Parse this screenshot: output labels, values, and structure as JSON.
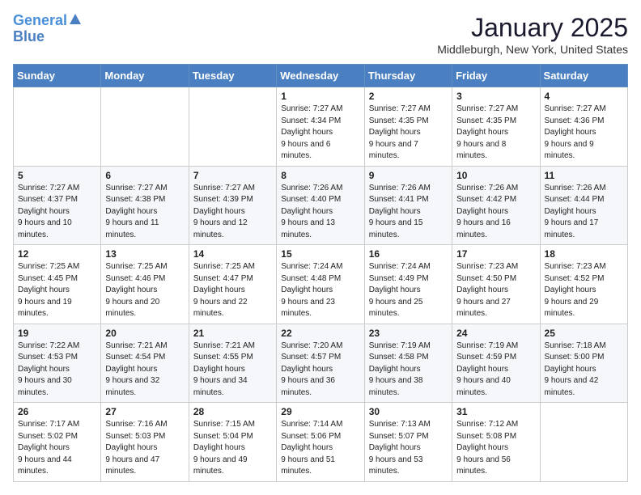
{
  "header": {
    "logo_line1": "General",
    "logo_line2": "Blue",
    "month": "January 2025",
    "location": "Middleburgh, New York, United States"
  },
  "days_of_week": [
    "Sunday",
    "Monday",
    "Tuesday",
    "Wednesday",
    "Thursday",
    "Friday",
    "Saturday"
  ],
  "weeks": [
    [
      {
        "day": "",
        "sunrise": "",
        "sunset": "",
        "daylight": ""
      },
      {
        "day": "",
        "sunrise": "",
        "sunset": "",
        "daylight": ""
      },
      {
        "day": "",
        "sunrise": "",
        "sunset": "",
        "daylight": ""
      },
      {
        "day": "1",
        "sunrise": "7:27 AM",
        "sunset": "4:34 PM",
        "daylight": "9 hours and 6 minutes."
      },
      {
        "day": "2",
        "sunrise": "7:27 AM",
        "sunset": "4:35 PM",
        "daylight": "9 hours and 7 minutes."
      },
      {
        "day": "3",
        "sunrise": "7:27 AM",
        "sunset": "4:35 PM",
        "daylight": "9 hours and 8 minutes."
      },
      {
        "day": "4",
        "sunrise": "7:27 AM",
        "sunset": "4:36 PM",
        "daylight": "9 hours and 9 minutes."
      }
    ],
    [
      {
        "day": "5",
        "sunrise": "7:27 AM",
        "sunset": "4:37 PM",
        "daylight": "9 hours and 10 minutes."
      },
      {
        "day": "6",
        "sunrise": "7:27 AM",
        "sunset": "4:38 PM",
        "daylight": "9 hours and 11 minutes."
      },
      {
        "day": "7",
        "sunrise": "7:27 AM",
        "sunset": "4:39 PM",
        "daylight": "9 hours and 12 minutes."
      },
      {
        "day": "8",
        "sunrise": "7:26 AM",
        "sunset": "4:40 PM",
        "daylight": "9 hours and 13 minutes."
      },
      {
        "day": "9",
        "sunrise": "7:26 AM",
        "sunset": "4:41 PM",
        "daylight": "9 hours and 15 minutes."
      },
      {
        "day": "10",
        "sunrise": "7:26 AM",
        "sunset": "4:42 PM",
        "daylight": "9 hours and 16 minutes."
      },
      {
        "day": "11",
        "sunrise": "7:26 AM",
        "sunset": "4:44 PM",
        "daylight": "9 hours and 17 minutes."
      }
    ],
    [
      {
        "day": "12",
        "sunrise": "7:25 AM",
        "sunset": "4:45 PM",
        "daylight": "9 hours and 19 minutes."
      },
      {
        "day": "13",
        "sunrise": "7:25 AM",
        "sunset": "4:46 PM",
        "daylight": "9 hours and 20 minutes."
      },
      {
        "day": "14",
        "sunrise": "7:25 AM",
        "sunset": "4:47 PM",
        "daylight": "9 hours and 22 minutes."
      },
      {
        "day": "15",
        "sunrise": "7:24 AM",
        "sunset": "4:48 PM",
        "daylight": "9 hours and 23 minutes."
      },
      {
        "day": "16",
        "sunrise": "7:24 AM",
        "sunset": "4:49 PM",
        "daylight": "9 hours and 25 minutes."
      },
      {
        "day": "17",
        "sunrise": "7:23 AM",
        "sunset": "4:50 PM",
        "daylight": "9 hours and 27 minutes."
      },
      {
        "day": "18",
        "sunrise": "7:23 AM",
        "sunset": "4:52 PM",
        "daylight": "9 hours and 29 minutes."
      }
    ],
    [
      {
        "day": "19",
        "sunrise": "7:22 AM",
        "sunset": "4:53 PM",
        "daylight": "9 hours and 30 minutes."
      },
      {
        "day": "20",
        "sunrise": "7:21 AM",
        "sunset": "4:54 PM",
        "daylight": "9 hours and 32 minutes."
      },
      {
        "day": "21",
        "sunrise": "7:21 AM",
        "sunset": "4:55 PM",
        "daylight": "9 hours and 34 minutes."
      },
      {
        "day": "22",
        "sunrise": "7:20 AM",
        "sunset": "4:57 PM",
        "daylight": "9 hours and 36 minutes."
      },
      {
        "day": "23",
        "sunrise": "7:19 AM",
        "sunset": "4:58 PM",
        "daylight": "9 hours and 38 minutes."
      },
      {
        "day": "24",
        "sunrise": "7:19 AM",
        "sunset": "4:59 PM",
        "daylight": "9 hours and 40 minutes."
      },
      {
        "day": "25",
        "sunrise": "7:18 AM",
        "sunset": "5:00 PM",
        "daylight": "9 hours and 42 minutes."
      }
    ],
    [
      {
        "day": "26",
        "sunrise": "7:17 AM",
        "sunset": "5:02 PM",
        "daylight": "9 hours and 44 minutes."
      },
      {
        "day": "27",
        "sunrise": "7:16 AM",
        "sunset": "5:03 PM",
        "daylight": "9 hours and 47 minutes."
      },
      {
        "day": "28",
        "sunrise": "7:15 AM",
        "sunset": "5:04 PM",
        "daylight": "9 hours and 49 minutes."
      },
      {
        "day": "29",
        "sunrise": "7:14 AM",
        "sunset": "5:06 PM",
        "daylight": "9 hours and 51 minutes."
      },
      {
        "day": "30",
        "sunrise": "7:13 AM",
        "sunset": "5:07 PM",
        "daylight": "9 hours and 53 minutes."
      },
      {
        "day": "31",
        "sunrise": "7:12 AM",
        "sunset": "5:08 PM",
        "daylight": "9 hours and 56 minutes."
      },
      {
        "day": "",
        "sunrise": "",
        "sunset": "",
        "daylight": ""
      }
    ]
  ]
}
